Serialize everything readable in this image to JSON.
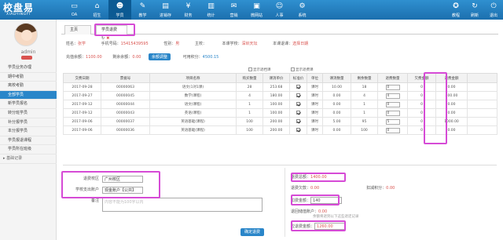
{
  "app": {
    "name": "校盘易",
    "subtitle": "XIADYINGYI"
  },
  "nav": [
    {
      "label": "OA",
      "icon": "computer-icon"
    },
    {
      "label": "招生",
      "icon": "home-icon"
    },
    {
      "label": "学员",
      "icon": "student-icon"
    },
    {
      "label": "教学",
      "icon": "teach-icon"
    },
    {
      "label": "进销存",
      "icon": "inventory-icon"
    },
    {
      "label": "财务",
      "icon": "finance-icon"
    },
    {
      "label": "统计",
      "icon": "stats-icon"
    },
    {
      "label": "营销",
      "icon": "marketing-icon"
    },
    {
      "label": "微网站",
      "icon": "website-icon"
    },
    {
      "label": "人事",
      "icon": "hr-icon"
    },
    {
      "label": "系统",
      "icon": "gear-icon"
    }
  ],
  "right_nav": [
    {
      "label": "教程"
    },
    {
      "label": "刷新"
    },
    {
      "label": "退出"
    }
  ],
  "user": {
    "name": "admin"
  },
  "menu": [
    {
      "label": "学员业务办理"
    },
    {
      "label": "期中考勤"
    },
    {
      "label": "离校考勤"
    },
    {
      "label": "全部学员"
    },
    {
      "label": "新学员报名"
    },
    {
      "label": "转分班学员"
    },
    {
      "label": "补分报学员"
    },
    {
      "label": "本分报学员"
    },
    {
      "label": "学员报退课程"
    },
    {
      "label": "学员所在班级"
    },
    {
      "label": "基础记录"
    }
  ],
  "tabs": {
    "home": "主页",
    "current": "学员退费"
  },
  "student": {
    "name_label": "姓名：",
    "name": "张学",
    "phone_label": "手机号码：",
    "phone": "15415439595",
    "gender_label": "性别：",
    "gender": "男",
    "school_label": "主校：",
    "school": "",
    "enroll_school_label": "本课学校：",
    "enroll_school": "深圳天坛",
    "enroll_label": "本课退课：",
    "enroll": "选择日期",
    "recharge_label": "充值余额：",
    "recharge": "1100.00",
    "balance_label": "剩余余额：",
    "balance": "0.00",
    "adjust_btn": "余额调整",
    "refundable_label": "可用积分：",
    "refundable": "4500.15"
  },
  "filters": {
    "f1": "显示退档课",
    "f2": "显示退费课"
  },
  "table": {
    "headers": [
      "交费日期",
      "票据号",
      "项目名称",
      "购买数量",
      "课消单价",
      "标准价",
      "单位",
      "课消数量",
      "剩余数量",
      "退费数量",
      "欠费金额",
      "退费金额"
    ],
    "rows": [
      [
        "2017-09-28",
        "00000063",
        "语文(1对1课)",
        "28",
        "253.68",
        "",
        "课时",
        "10.00",
        "18",
        "0",
        "0",
        "0.00"
      ],
      [
        "2017-09-27",
        "00000045",
        "数学(课程)",
        "4",
        "180.00",
        "",
        "课时",
        "0.00",
        "4",
        "4",
        "0",
        "400.00"
      ],
      [
        "2017-09-12",
        "00000044",
        "语文(课程)",
        "1",
        "100.00",
        "",
        "课时",
        "0.00",
        "1",
        "0",
        "0",
        "0.00"
      ],
      [
        "2017-09-12",
        "00000043",
        "英语(课程)",
        "1",
        "100.00",
        "",
        "课时",
        "0.00",
        "1",
        "0",
        "0",
        "0.00"
      ],
      [
        "2017-09-06",
        "00000037",
        "英语基础(课程)",
        "100",
        "200.00",
        "",
        "课时",
        "5.00",
        "95",
        "5",
        "0",
        "1000.00"
      ],
      [
        "2017-09-06",
        "00000036",
        "英语基础(课程)",
        "100",
        "200.00",
        "",
        "课时",
        "0.00",
        "100",
        "0",
        "0",
        "0.00"
      ]
    ],
    "checked": [
      true,
      true,
      true,
      true,
      true,
      true
    ]
  },
  "form_left": {
    "campus_label": "退费校区",
    "campus": "广州校区",
    "account_label": "学校支出账户",
    "account": "现金账户【公共】",
    "remark_label": "备注",
    "remark_placeholder": "内容不能为100字以内"
  },
  "form_right": {
    "refund_total_label": "退费总额：",
    "refund_total": "1400.00",
    "debt_label": "退费欠款：",
    "debt": "0.00",
    "points_label": "扣减积分：",
    "points": "0.00",
    "fee_label": "扣费金额：",
    "fee": "140",
    "account_label": "退回储值账户：",
    "account": "0.00",
    "account_note": "余额将退到以下这些退还记录",
    "actual_label": "应退费金额：",
    "actual": "1260.00"
  },
  "submit_label": "确定退费"
}
